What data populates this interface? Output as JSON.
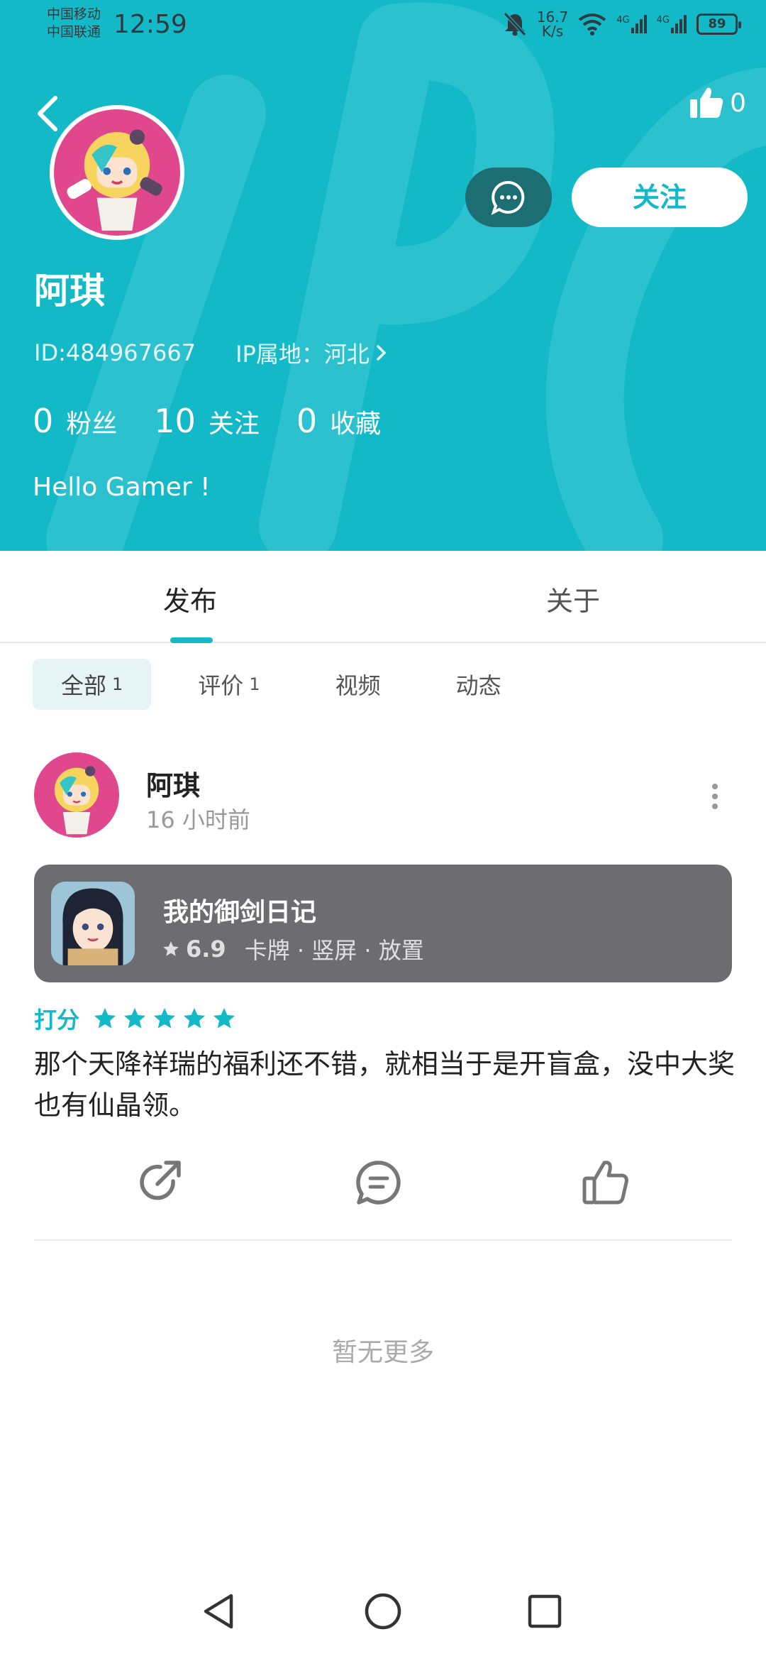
{
  "status_bar": {
    "carrier_1": "中国移动",
    "carrier_2": "中国联通",
    "time": "12:59",
    "net_speed_value": "16.7",
    "net_speed_unit": "K/s",
    "signal_1": "4G",
    "signal_2": "4G",
    "battery": "89"
  },
  "header": {
    "bg_color": "#14b9c8",
    "like_count": "0",
    "chat_icon": "chat-bubble-icon",
    "follow_label": "关注",
    "username": "阿琪",
    "user_id": "ID:484967667",
    "ip_location": "IP属地：河北",
    "stats": [
      {
        "value": "0",
        "label": "粉丝"
      },
      {
        "value": "10",
        "label": "关注"
      },
      {
        "value": "0",
        "label": "收藏"
      }
    ],
    "bio": "Hello Gamer !"
  },
  "tabs": [
    {
      "label": "发布",
      "active": true
    },
    {
      "label": "关于",
      "active": false
    }
  ],
  "subtabs": [
    {
      "label": "全部",
      "count": "1",
      "active": true
    },
    {
      "label": "评价",
      "count": "1",
      "active": false
    },
    {
      "label": "视频",
      "count": "",
      "active": false
    },
    {
      "label": "动态",
      "count": "",
      "active": false
    }
  ],
  "post": {
    "author": "阿琪",
    "time": "16 小时前",
    "game": {
      "title": "我的御剑日记",
      "rating": "6.9",
      "tags": "卡牌 · 竖屏 · 放置"
    },
    "score_label": "打分",
    "stars": 5,
    "text": "那个天降祥瑞的福利还不错，就相当于是开盲盒，没中大奖也有仙晶领。",
    "actions": [
      "share-icon",
      "comment-icon",
      "thumbs-up-icon"
    ]
  },
  "footer_text": "暂无更多",
  "accent_color": "#14b9c8"
}
